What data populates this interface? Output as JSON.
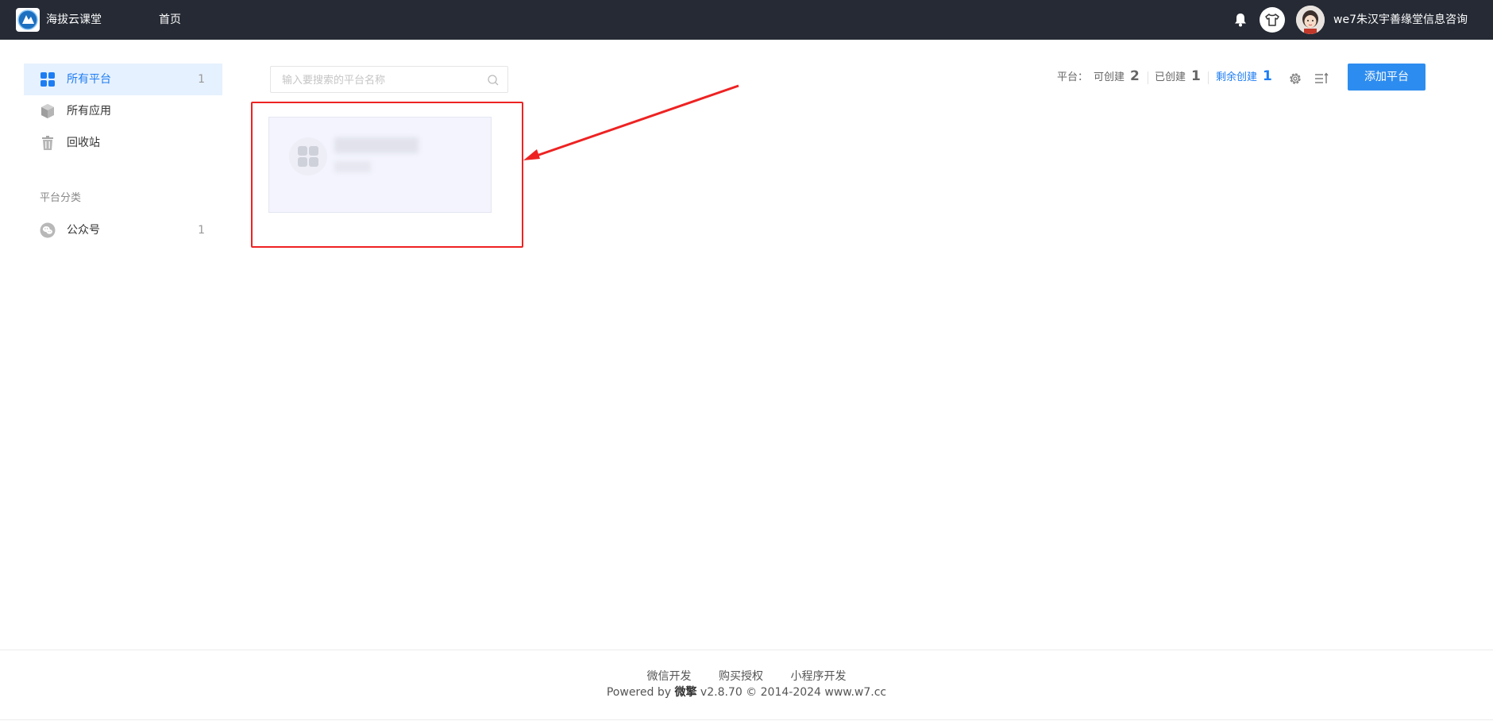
{
  "topbar": {
    "app_name": "海拔云课堂",
    "nav_home": "首页",
    "username": "we7朱汉宇善缘堂信息咨询"
  },
  "sidebar": {
    "items": [
      {
        "label": "所有平台",
        "count": "1"
      },
      {
        "label": "所有应用"
      },
      {
        "label": "回收站"
      }
    ],
    "section_title": "平台分类",
    "categories": [
      {
        "label": "公众号",
        "count": "1"
      }
    ]
  },
  "search": {
    "placeholder": "输入要搜索的平台名称"
  },
  "stats": {
    "prefix": "平台：",
    "can_create_label": "可创建",
    "can_create_value": "2",
    "created_label": "已创建",
    "created_value": "1",
    "remaining_label": "剩余创建",
    "remaining_value": "1"
  },
  "actions": {
    "add_platform": "添加平台"
  },
  "colors": {
    "topbar_bg": "#252a34",
    "accent": "#1e7df3",
    "button": "#2d8cf0",
    "annotation": "#ee2222"
  },
  "footer": {
    "links": [
      "微信开发",
      "购买授权",
      "小程序开发"
    ],
    "powered_prefix": "Powered by",
    "powered_brand": "微擎",
    "powered_suffix": "v2.8.70 © 2014-2024 www.w7.cc"
  }
}
